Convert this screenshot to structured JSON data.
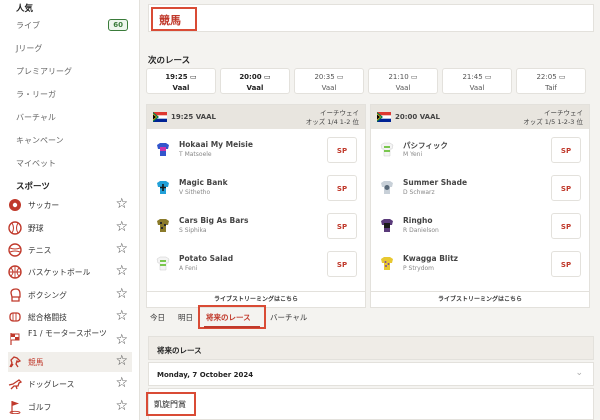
{
  "sidebar": {
    "popular_header": "人気",
    "items": [
      {
        "label": "ライブ",
        "badge": "60"
      },
      {
        "label": "Jリーグ"
      },
      {
        "label": "プレミアリーグ"
      },
      {
        "label": "ラ・リーガ"
      },
      {
        "label": "バーチャル"
      },
      {
        "label": "キャンペーン"
      },
      {
        "label": "マイベット"
      }
    ],
    "sports_header": "スポーツ",
    "sports": [
      {
        "label": "サッカー",
        "icon": "soccer-icon"
      },
      {
        "label": "野球",
        "icon": "baseball-icon"
      },
      {
        "label": "テニス",
        "icon": "tennis-icon"
      },
      {
        "label": "バスケットボール",
        "icon": "basketball-icon"
      },
      {
        "label": "ボクシング",
        "icon": "boxing-icon"
      },
      {
        "label": "総合格闘技",
        "icon": "mma-icon"
      },
      {
        "label": "F1 / モータースポーツ",
        "icon": "motorsport-icon"
      },
      {
        "label": "競馬",
        "icon": "horse-racing-icon",
        "active": true
      },
      {
        "label": "ドッグレース",
        "icon": "greyhound-icon"
      },
      {
        "label": "ゴルフ",
        "icon": "golf-icon"
      }
    ]
  },
  "page_title": "競馬",
  "next_races_label": "次のレース",
  "time_tabs": [
    {
      "time": "19:25",
      "venue": "Vaal",
      "bold": true
    },
    {
      "time": "20:00",
      "venue": "Vaal",
      "bold": true
    },
    {
      "time": "20:35",
      "venue": "Vaal",
      "bold": false
    },
    {
      "time": "21:10",
      "venue": "Vaal",
      "bold": false
    },
    {
      "time": "21:45",
      "venue": "Vaal",
      "bold": false
    },
    {
      "time": "22:05",
      "venue": "Taif",
      "bold": false
    }
  ],
  "race_cards": [
    {
      "time_venue": "19:25 VAAL",
      "terms1": "イーチウェイ",
      "terms2": "オッズ 1/4 1-2 位",
      "runners": [
        {
          "name": "Hokaai My Meisie",
          "jockey": "T Matsoele",
          "odds": "SP",
          "silk1": "#3355cc",
          "silk2": "#cc33aa"
        },
        {
          "name": "Magic Bank",
          "jockey": "V Sithetho",
          "odds": "SP",
          "silk1": "#22a0d8",
          "silk2": "#1a1a1a"
        },
        {
          "name": "Cars Big As Bars",
          "jockey": "S Siphika",
          "odds": "SP",
          "silk1": "#8a7a2a",
          "silk2": "#2a2a2a"
        },
        {
          "name": "Potato Salad",
          "jockey": "A Feni",
          "odds": "SP",
          "silk1": "#7ac74f",
          "silk2": "#f4f4f4"
        }
      ],
      "live": "ライブストリーミングはこちら"
    },
    {
      "time_venue": "20:00 VAAL",
      "terms1": "イーチウェイ",
      "terms2": "オッズ 1/5 1-2-3 位",
      "runners": [
        {
          "name": "パシフィック",
          "jockey": "M Yeni",
          "odds": "SP",
          "silk1": "#7ac74f",
          "silk2": "#f4f4f4"
        },
        {
          "name": "Summer Shade",
          "jockey": "D Schwarz",
          "odds": "SP",
          "silk1": "#c8d0d8",
          "silk2": "#5a6a7a"
        },
        {
          "name": "Ringho",
          "jockey": "R Danielson",
          "odds": "SP",
          "silk1": "#5a3a7a",
          "silk2": "#1a1a1a"
        },
        {
          "name": "Kwagga Blitz",
          "jockey": "P Strydom",
          "odds": "SP",
          "silk1": "#e8c830",
          "silk2": "#7a4a9a"
        }
      ],
      "live": "ライブストリーミングはこちら"
    }
  ],
  "filter_tabs": [
    "今日",
    "明日",
    "将来のレース",
    "バーチャル"
  ],
  "future_races_title": "将来のレース",
  "date_label": "Monday, 7 October 2024",
  "venue_label": "凱旋門賞",
  "colors": {
    "accent": "#c0392b",
    "highlight": "#d94b35",
    "badge": "#3a7b3a"
  }
}
